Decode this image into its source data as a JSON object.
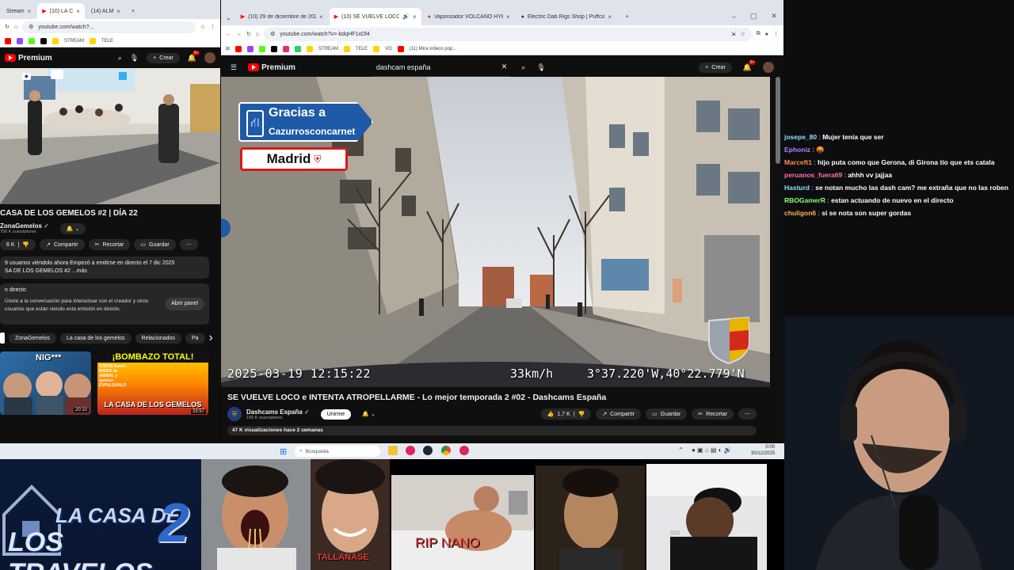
{
  "left_browser": {
    "tabs": [
      {
        "label": "Stream"
      },
      {
        "label": "(10) LA C"
      },
      {
        "label": "(14) ALM"
      }
    ],
    "url": "youtube.com/watch?...",
    "bookmarks": [
      "STREAM",
      "TELE"
    ],
    "premium_label": "Premium",
    "create_label": "Crear",
    "notif_count": "9+",
    "video_title": "CASA DE LOS GEMELOS #2 | DÍA 22",
    "channel_name": "ZonaGemelos",
    "subscribers": "750 K suscriptores",
    "like_count": "6 K",
    "share_label": "Compartir",
    "clip_label": "Recortar",
    "save_label": "Guardar",
    "desc_line1": "9 usuarios viéndolo ahora  Empezó a emitirse en directo el 7 dic 2025",
    "desc_line2": "SA DE LOS GEMELOS #2 ...más",
    "chat_header": "n directo",
    "chat_prompt": "Únete a la conversación para interactuar con el creador y otros usuarios que están viendo esta emisión en directo.",
    "open_panel_label": "Abrir panel",
    "chips": [
      "ZonaGemelos",
      "La casa de los gemelos",
      "Relacionados",
      "Pa"
    ],
    "rec_1_badge_text": "NIG***",
    "rec_1_time": "20:10",
    "rec_2_top": "¡BOMBAZO TOTAL!",
    "rec_2_sub": "TODOS tienen MIEDO de ANIBAL y quieren EXPULSARLO",
    "rec_2_bottom": "LA CASA DE LOS GEMELOS",
    "rec_2_time": "33:57"
  },
  "right_browser": {
    "tabs": [
      {
        "label": "(10) 29 de diciembre de 2025"
      },
      {
        "label": "(10) SE VUELVE LOCO e INT"
      },
      {
        "label": "Vaporizador VOLCANO HYBRI"
      },
      {
        "label": "Electric Dab Rigs Shop | Puffco"
      }
    ],
    "url": "youtube.com/watch?v=-bdqHF1xDf4",
    "bookmarks": [
      "STREAM",
      "TELE",
      "VO",
      "(11) Mira vídeos pop..."
    ],
    "premium_label": "Premium",
    "search_query": "dashcam españa",
    "create_label": "Crear",
    "notif_count": "9+",
    "overlay_sign_line1": "Gracias a",
    "overlay_sign_line2": "Cazurrosconcarnet",
    "overlay_city": "Madrid",
    "timestamp": "2025-03-19 12:15:22",
    "speed": "33km/h",
    "gps": "3°37.220'W,40°22.779'N",
    "video_title": "SE VUELVE LOCO e INTENTA ATROPELLARME - Lo mejor temporada 2 #02 - Dashcams España",
    "channel_name": "Dashcams España",
    "subscribers": "105 K suscriptores",
    "join_label": "Unirme",
    "like_count": "1,7 K",
    "share_label": "Compartir",
    "save_label": "Guardar",
    "clip_label": "Recortar",
    "views": "47 K visualizaciones  hace 2 semanas"
  },
  "taskbar": {
    "search_placeholder": "Búsqueda",
    "time": "0:00",
    "date": "30/12/2025"
  },
  "chat": [
    {
      "user": "josepe_80",
      "color": "#8be0ff",
      "msg": "Mujer tenía que ser"
    },
    {
      "user": "Ephoniz",
      "color": "#b084ff",
      "msg": "🤬"
    },
    {
      "user": "Marceft1",
      "color": "#ff8c4a",
      "msg": "hijo puta como que Gerona, di Girona tío que ets catala"
    },
    {
      "user": "peruanos_fuera69",
      "color": "#ff6fb1",
      "msg": "ahhh vv jajjaa"
    },
    {
      "user": "Hasturd",
      "color": "#8be0ff",
      "msg": "se notan mucho las dash cam? me extraña que no las roben"
    },
    {
      "user": "RBOGamerR",
      "color": "#8cff7a",
      "msg": "estan actuando de nuevo en el directo"
    },
    {
      "user": "chuligon6",
      "color": "#ffb347",
      "msg": "si se nota son super gordas"
    }
  ],
  "bottom": {
    "logo_line1": "LA CASA DE",
    "logo_line2": "LOS TRAVELOS",
    "logo_number": "2",
    "caption_1": "TALLANASE",
    "caption_2": "RIP NANO"
  },
  "colors": {
    "yt_red": "#ff0000",
    "chrome_tabs": "#dfe3eb",
    "yt_dark": "#0f0f0f"
  }
}
